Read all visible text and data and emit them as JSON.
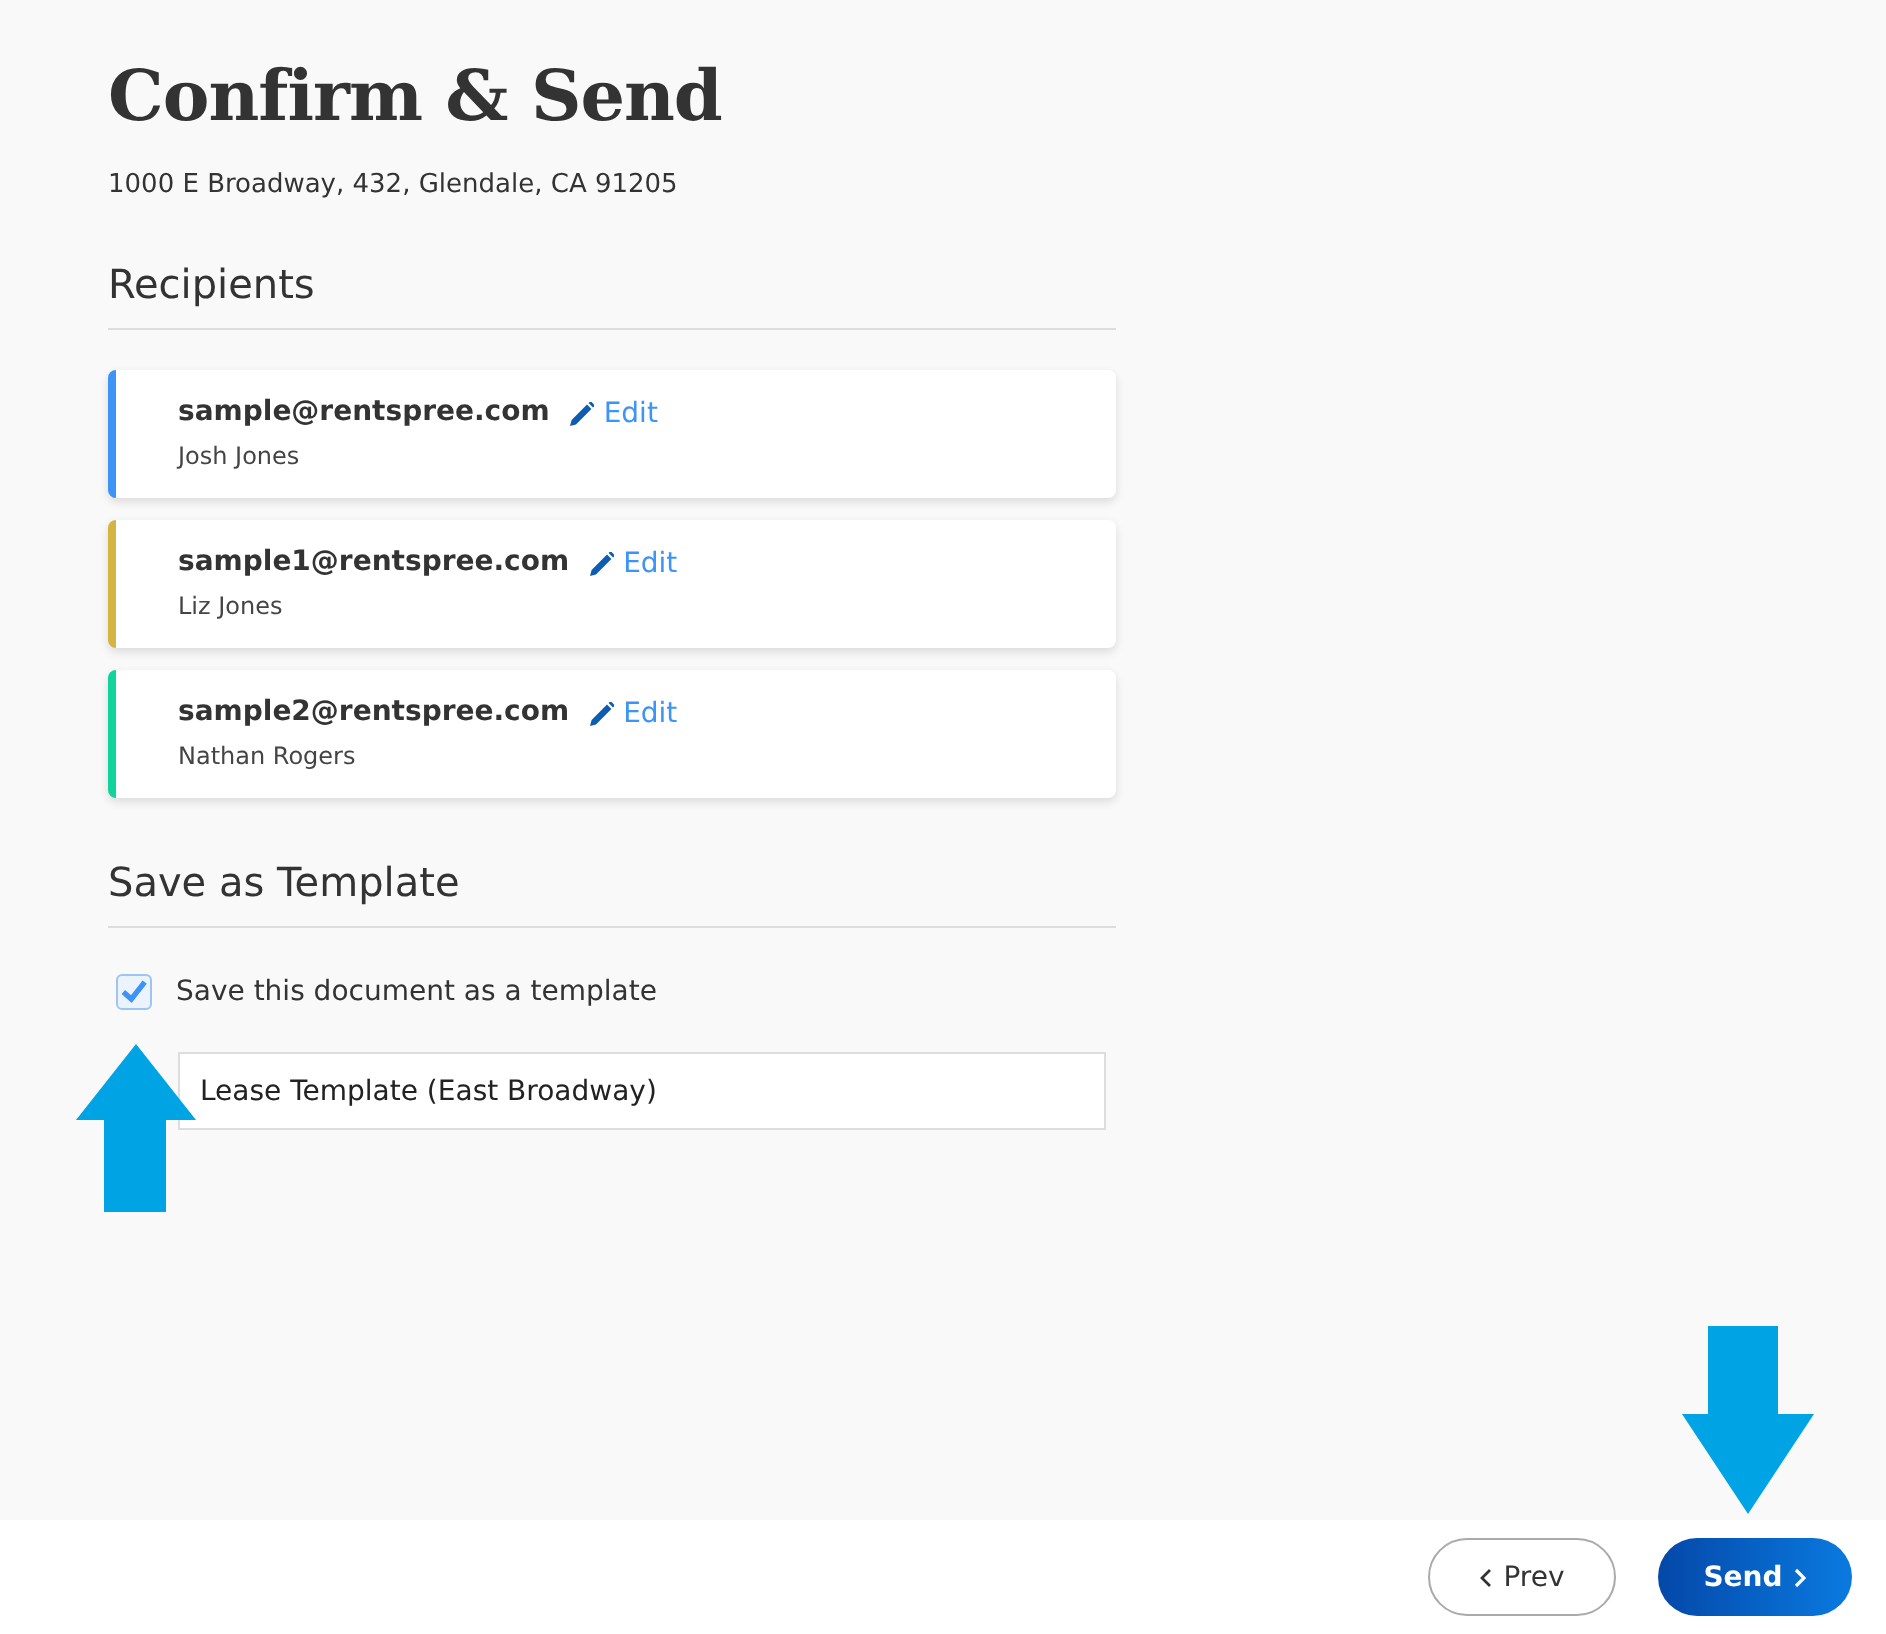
{
  "title": "Confirm & Send",
  "address": "1000 E Broadway, 432, Glendale, CA 91205",
  "recipients_heading": "Recipients",
  "recipients": [
    {
      "email": "sample@rentspree.com",
      "name": "Josh Jones",
      "edit": "Edit",
      "color": "#3d94f6"
    },
    {
      "email": "sample1@rentspree.com",
      "name": "Liz Jones",
      "edit": "Edit",
      "color": "#d4b443"
    },
    {
      "email": "sample2@rentspree.com",
      "name": "Nathan Rogers",
      "edit": "Edit",
      "color": "#11d39c"
    }
  ],
  "template_heading": "Save as Template",
  "save_template": {
    "label": "Save this document as a template",
    "checked": true
  },
  "template_name": {
    "value": "Lease Template (East Broadway)"
  },
  "buttons": {
    "prev": "Prev",
    "send": "Send"
  }
}
